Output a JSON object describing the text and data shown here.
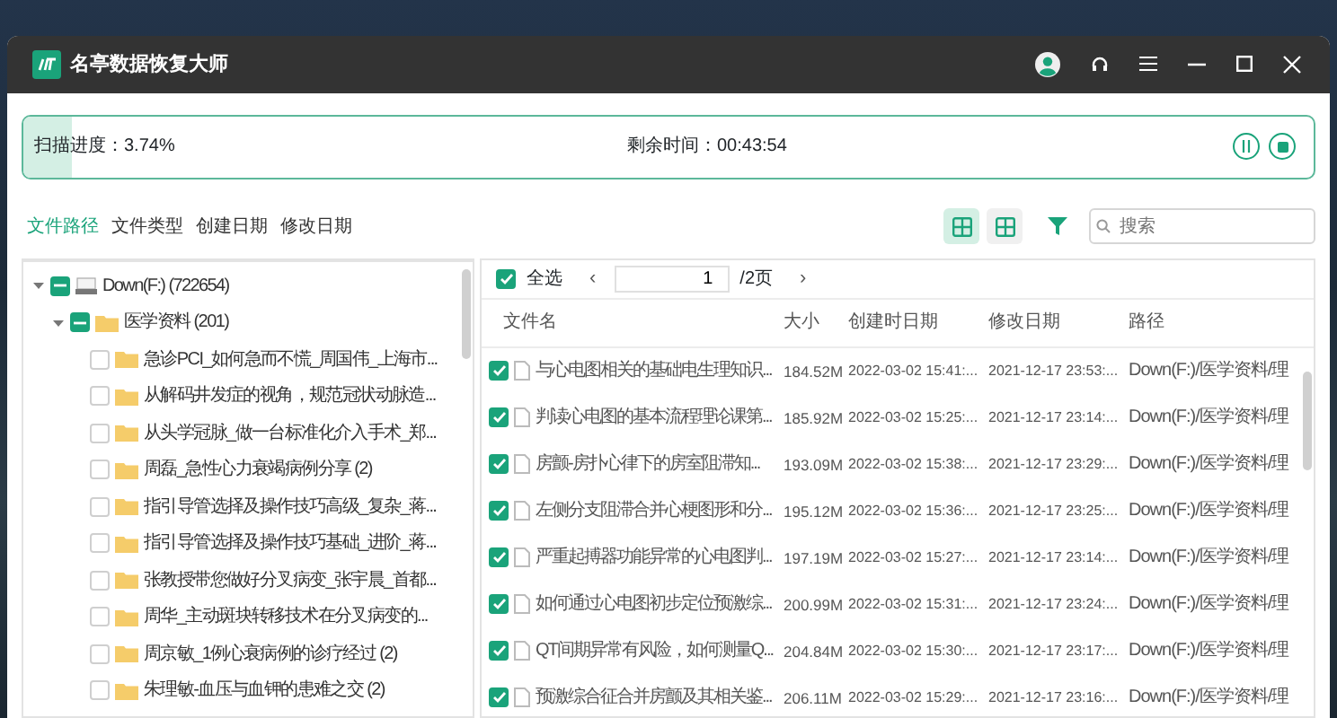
{
  "window": {
    "title": "名亭数据恢复大师"
  },
  "scan": {
    "progress_label": "扫描进度：3.74%",
    "level": 0.0374,
    "remaining_label": "剩余时间：00:43:54"
  },
  "filter_tabs": [
    {
      "label": "文件路径",
      "selected": true
    },
    {
      "label": "文件类型",
      "selected": false
    },
    {
      "label": "创建日期",
      "selected": false
    },
    {
      "label": "修改日期",
      "selected": false
    }
  ],
  "view_buttons": [
    {
      "selected": true
    },
    {
      "selected": false
    }
  ],
  "search": {
    "placeholder": "搜索"
  },
  "tree": [
    {
      "label": "Down(F:) (722654)",
      "kind": "drive",
      "checked": true,
      "partial": true,
      "expanded": true,
      "children": [
        {
          "label": "医学资料 (201)",
          "kind": "folder",
          "checked": true,
          "partial": true,
          "expanded": true,
          "children": [
            {
              "label": "急诊PCI_如何急而不慌_周国伟_上海市...",
              "kind": "folder",
              "checked": false
            },
            {
              "label": "从解码井发症的视角，规范冠状动脉造...",
              "kind": "folder",
              "checked": false
            },
            {
              "label": "从头学冠脉_做一台标准化介入手术_郑...",
              "kind": "folder",
              "checked": false
            },
            {
              "label": "周磊_急性心力衰竭病例分享 (2)",
              "kind": "folder",
              "checked": false
            },
            {
              "label": "指引导管选择及操作技巧高级_复杂_蒋...",
              "kind": "folder",
              "checked": false
            },
            {
              "label": "指引导管选择及操作技巧基础_进阶_蒋...",
              "kind": "folder",
              "checked": false
            },
            {
              "label": "张教授带您做好分叉病变_张宇晨_首都...",
              "kind": "folder",
              "checked": false
            },
            {
              "label": "周华_主动斑块转移技术在分叉病变的...",
              "kind": "folder",
              "checked": false
            },
            {
              "label": "周京敏_1例心衰病例的诊疗经过 (2)",
              "kind": "folder",
              "checked": false
            },
            {
              "label": "朱理敏-血压与血钾的患难之交 (2)",
              "kind": "folder",
              "checked": false
            }
          ]
        }
      ]
    }
  ],
  "pager": {
    "select_all_label": "全选",
    "select_all_checked": true,
    "prev": "‹",
    "page": "1",
    "total": "/2页",
    "next": "›"
  },
  "table": {
    "columns": [
      "文件名",
      "大小",
      "创建时日期",
      "修改日期",
      "路径"
    ],
    "rows": [
      {
        "checked": true,
        "cells": [
          "与心电图相关的基础电生理知识...",
          "184.52M",
          "2022-03-02 15:41:...",
          "2021-12-17 23:53:...",
          "Down(F:)/医学资料/理"
        ]
      },
      {
        "checked": true,
        "cells": [
          "判读心电图的基本流程理论课第...",
          "185.92M",
          "2022-03-02 15:25:...",
          "2021-12-17 23:14:...",
          "Down(F:)/医学资料/理"
        ]
      },
      {
        "checked": true,
        "cells": [
          "房颤-房扑心律下的房室阻滞知...",
          "193.09M",
          "2022-03-02 15:38:...",
          "2021-12-17 23:29:...",
          "Down(F:)/医学资料/理"
        ]
      },
      {
        "checked": true,
        "cells": [
          "左侧分支阻滞合并心梗图形和分...",
          "195.12M",
          "2022-03-02 15:36:...",
          "2021-12-17 23:25:...",
          "Down(F:)/医学资料/理"
        ]
      },
      {
        "checked": true,
        "cells": [
          "严重起搏器功能异常的心电图判...",
          "197.19M",
          "2022-03-02 15:27:...",
          "2021-12-17 23:14:...",
          "Down(F:)/医学资料/理"
        ]
      },
      {
        "checked": true,
        "cells": [
          "如何通过心电图初步定位预激综...",
          "200.99M",
          "2022-03-02 15:31:...",
          "2021-12-17 23:24:...",
          "Down(F:)/医学资料/理"
        ]
      },
      {
        "checked": true,
        "cells": [
          "QT间期异常有风险，如何测量Q...",
          "204.84M",
          "2022-03-02 15:30:...",
          "2021-12-17 23:17:...",
          "Down(F:)/医学资料/理"
        ]
      },
      {
        "checked": true,
        "cells": [
          "预激综合征合并房颤及其相关鉴...",
          "206.11M",
          "2022-03-02 15:29:...",
          "2021-12-17 23:16:...",
          "Down(F:)/医学资料/理"
        ]
      }
    ]
  }
}
